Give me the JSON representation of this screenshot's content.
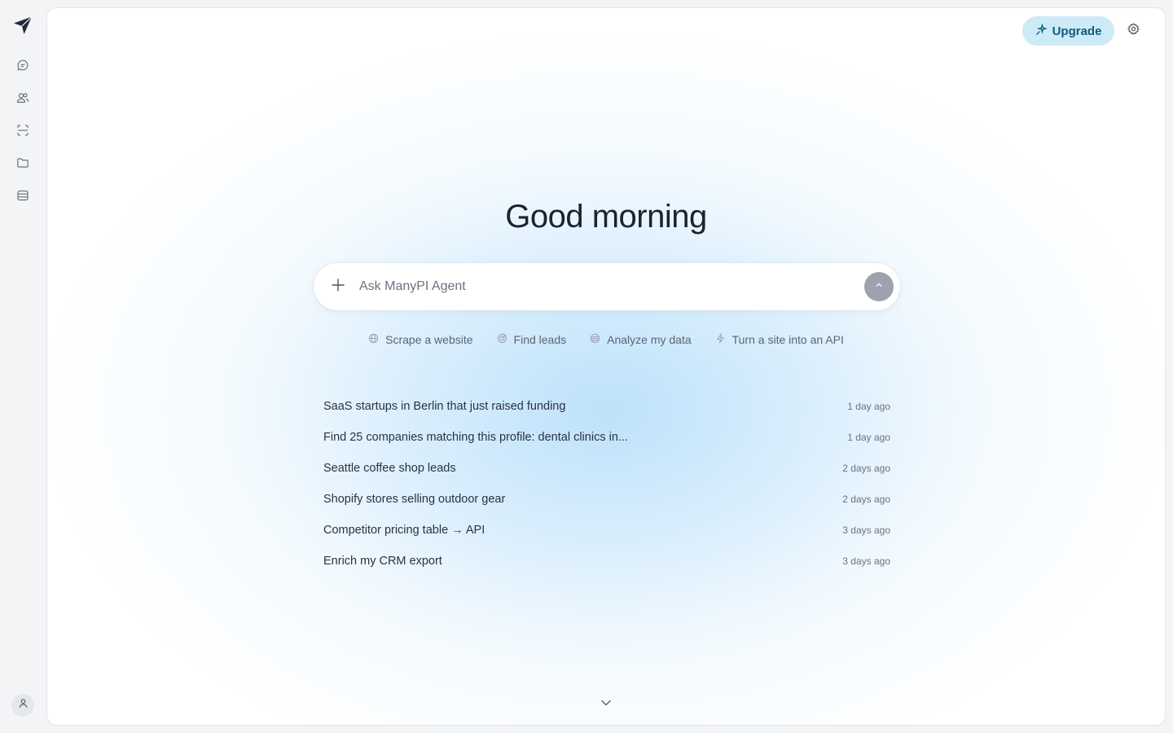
{
  "app": {
    "logo_icon": "paper-plane-icon"
  },
  "rail": {
    "items": [
      {
        "id": "chats",
        "icon": "chat-bubble-icon"
      },
      {
        "id": "people",
        "icon": "users-icon"
      },
      {
        "id": "scraper",
        "icon": "scan-icon"
      },
      {
        "id": "files",
        "icon": "folder-icon"
      },
      {
        "id": "data",
        "icon": "database-icon"
      }
    ],
    "user_icon": "user-icon"
  },
  "header": {
    "upgrade_label": "Upgrade",
    "upgrade_icon": "sparkle-icon",
    "settings_icon": "gear-icon"
  },
  "main": {
    "greeting": "Good morning",
    "composer": {
      "placeholder": "Ask ManyPI Agent",
      "value": "",
      "attach_icon": "plus-icon",
      "send_icon": "arrow-up-icon"
    },
    "suggestions": [
      {
        "label": "Scrape a website",
        "icon": "globe-icon"
      },
      {
        "label": "Find leads",
        "icon": "target-icon"
      },
      {
        "label": "Analyze my data",
        "icon": "database-icon"
      },
      {
        "label": "Turn a site into an API",
        "icon": "bolt-icon"
      }
    ],
    "recent": [
      {
        "title": "SaaS startups in Berlin that just raised funding",
        "time": "1 day ago"
      },
      {
        "title": "Find 25 companies matching this profile: dental clinics in...",
        "time": "1 day ago"
      },
      {
        "title": "Seattle coffee shop leads",
        "time": "2 days ago"
      },
      {
        "title": "Shopify stores selling outdoor gear",
        "time": "2 days ago"
      },
      {
        "title": "Competitor pricing table → API",
        "time": "3 days ago"
      },
      {
        "title": "Enrich my CRM export",
        "time": "3 days ago"
      }
    ],
    "scroll_icon": "chevron-down-icon"
  },
  "colors": {
    "accent_bg": "#cdeaf7",
    "accent_text": "#0e5a80",
    "glow": "#bae0fa",
    "send_disabled": "#9ca3af"
  }
}
